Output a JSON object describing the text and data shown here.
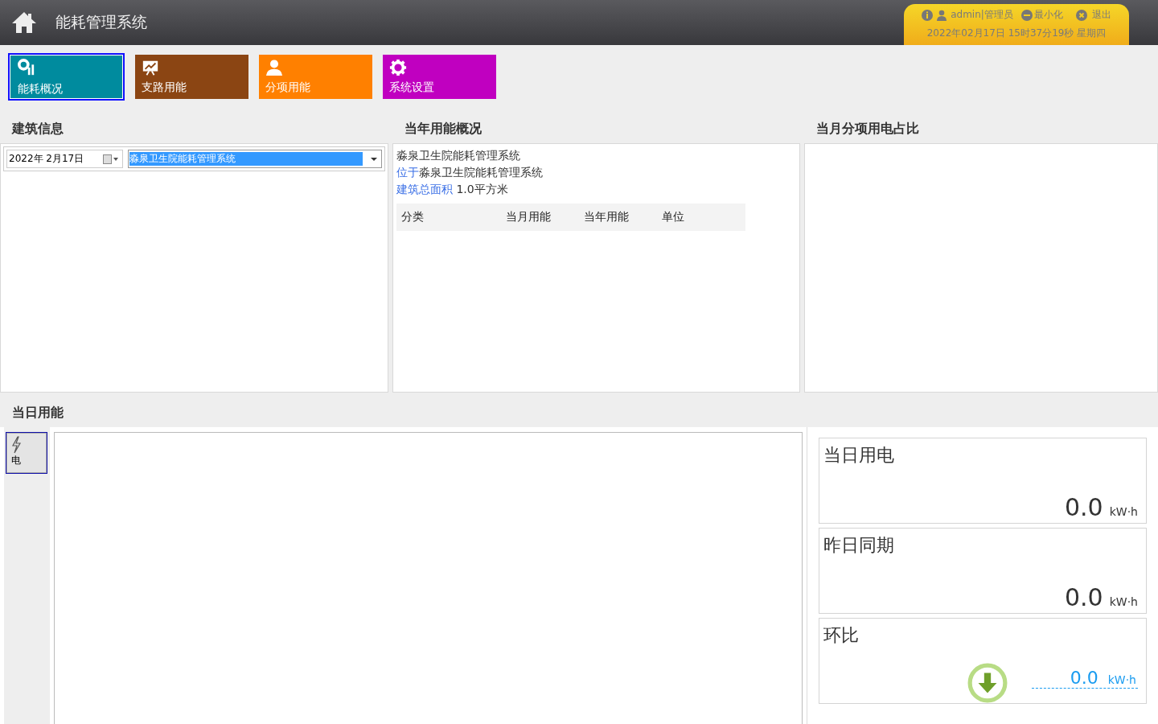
{
  "header": {
    "title": "能耗管理系统",
    "user": "admin|管理员",
    "minimize": "最小化",
    "logout": "退出",
    "datetime": "2022年02月17日 15时37分19秒 星期四"
  },
  "nav": [
    {
      "label": "能耗概况",
      "kind": "chart",
      "color": "#008b9e",
      "selected": true
    },
    {
      "label": "支路用能",
      "kind": "board",
      "color": "#8b4513",
      "selected": false
    },
    {
      "label": "分项用能",
      "kind": "person",
      "color": "#ff8000",
      "selected": false
    },
    {
      "label": "系统设置",
      "kind": "gear",
      "color": "#c000c0",
      "selected": false
    }
  ],
  "building_info": {
    "title": "建筑信息",
    "date": "2022年  2月17日",
    "building": "淼泉卫生院能耗管理系统"
  },
  "year_overview": {
    "title": "当年用能概况",
    "name": "淼泉卫生院能耗管理系统",
    "location_label": "位于",
    "location": "淼泉卫生院能耗管理系统",
    "area_label": "建筑总面积",
    "area": "1.0平方米",
    "columns": [
      "分类",
      "当月用能",
      "当年用能",
      "单位"
    ]
  },
  "month_share": {
    "title": "当月分项用电占比"
  },
  "daily": {
    "title": "当日用能",
    "energy_types": [
      {
        "label": "电",
        "selected": true
      }
    ],
    "stats": [
      {
        "kind": "plain",
        "title": "当日用电",
        "value": "0.0",
        "unit": "kW·h"
      },
      {
        "kind": "plain",
        "title": "昨日同期",
        "value": "0.0",
        "unit": "kW·h"
      },
      {
        "kind": "compare",
        "title": "环比",
        "value": "0.0",
        "unit": "kW·h"
      }
    ]
  }
}
